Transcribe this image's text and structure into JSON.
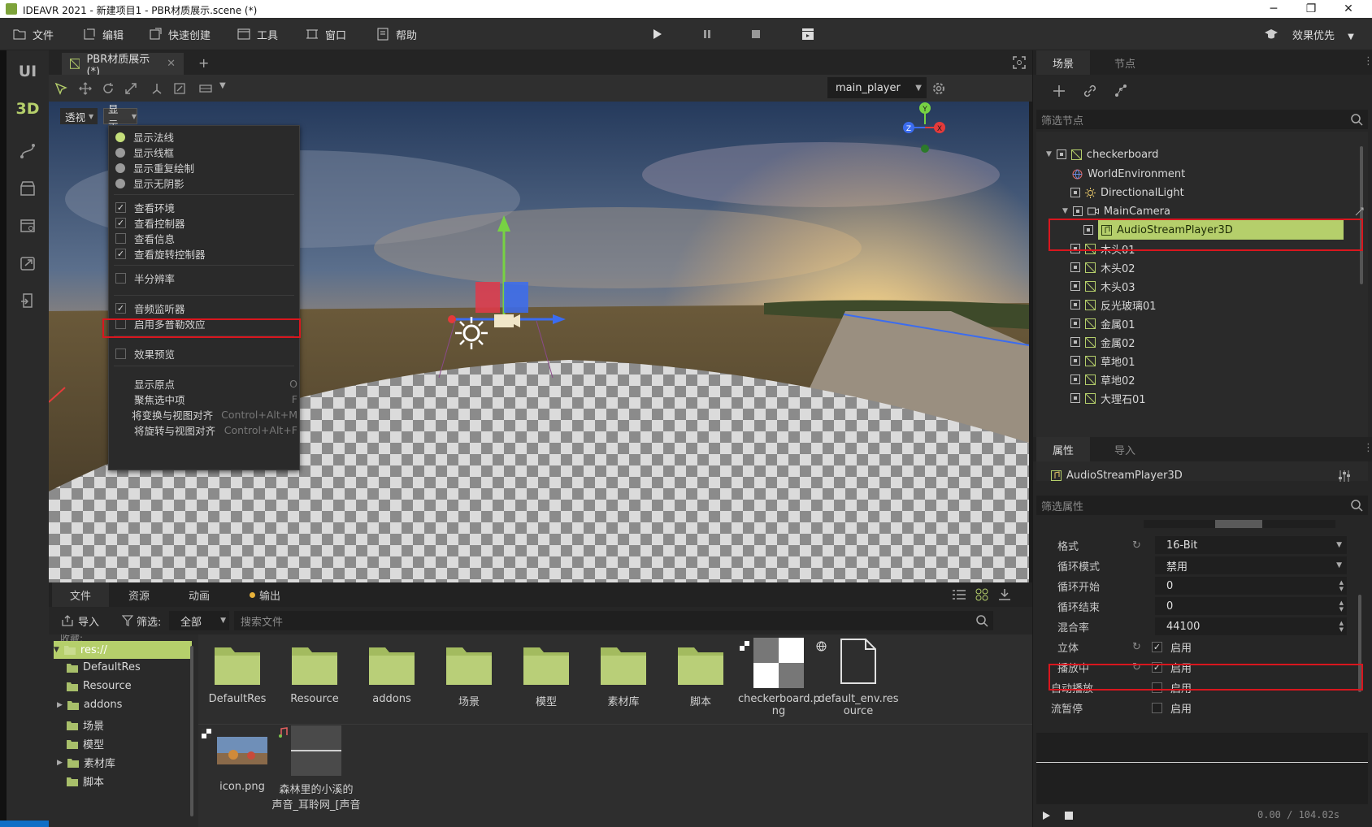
{
  "window": {
    "title": "IDEAVR 2021 - 新建项目1 - PBR材质展示.scene (*)",
    "minimize": "─",
    "maximize": "❐",
    "close": "✕"
  },
  "menubar": {
    "file": "文件",
    "edit": "编辑",
    "quick_create": "快速创建",
    "tools": "工具",
    "window": "窗口",
    "help": "帮助",
    "render_mode": "效果优先"
  },
  "leftdock": {
    "ui": "UI",
    "d3": "3D"
  },
  "editor": {
    "tab_label": "PBR材质展示(*)",
    "camera_select": "main_player",
    "view_persp": "透视",
    "view_display": "显示",
    "gizmo": {
      "x": "X",
      "y": "Y",
      "z": "Z"
    }
  },
  "display_menu": {
    "items": [
      {
        "label": "显示法线",
        "kind": "radio",
        "on": true
      },
      {
        "label": "显示线框",
        "kind": "radio",
        "on": false
      },
      {
        "label": "显示重复绘制",
        "kind": "radio",
        "on": false
      },
      {
        "label": "显示无阴影",
        "kind": "radio",
        "on": false
      },
      {
        "label": "查看环境",
        "kind": "check",
        "on": true
      },
      {
        "label": "查看控制器",
        "kind": "check",
        "on": true
      },
      {
        "label": "查看信息",
        "kind": "check",
        "on": false
      },
      {
        "label": "查看旋转控制器",
        "kind": "check",
        "on": true
      },
      {
        "label": "半分辨率",
        "kind": "check",
        "on": false
      },
      {
        "label": "音频监听器",
        "kind": "check",
        "on": true
      },
      {
        "label": "启用多普勒效应",
        "kind": "check",
        "on": false
      },
      {
        "label": "效果预览",
        "kind": "check",
        "on": false
      },
      {
        "label": "显示原点",
        "kind": "plain",
        "shortcut": "O"
      },
      {
        "label": "聚焦选中项",
        "kind": "plain",
        "shortcut": "F"
      },
      {
        "label": "将变换与视图对齐",
        "kind": "plain",
        "shortcut": "Control+Alt+M"
      },
      {
        "label": "将旋转与视图对齐",
        "kind": "plain",
        "shortcut": "Control+Alt+F"
      }
    ]
  },
  "bottom": {
    "tabs": [
      "文件",
      "资源",
      "动画",
      "输出"
    ],
    "import_label": "导入",
    "filter_label": "筛选:",
    "filter_value": "全部",
    "search_placeholder": "搜索文件",
    "fav_label": "收藏:",
    "tree": [
      "res://",
      "DefaultRes",
      "Resource",
      "addons",
      "场景",
      "模型",
      "素材库",
      "脚本"
    ],
    "files_row1": [
      "DefaultRes",
      "Resource",
      "addons",
      "场景",
      "模型",
      "素材库",
      "脚本"
    ],
    "checker_name": [
      "checkerboard.p",
      "ng"
    ],
    "env_name": [
      "default_env.res",
      "ource"
    ],
    "icon_name": "icon.png",
    "audio_name": [
      "森林里的小溪的",
      "声音_耳聆网_[声音"
    ]
  },
  "scene_panel": {
    "tabs": [
      "场景",
      "节点"
    ],
    "filter_placeholder": "筛选节点",
    "nodes": [
      {
        "label": "checkerboard"
      },
      {
        "label": "WorldEnvironment"
      },
      {
        "label": "DirectionalLight"
      },
      {
        "label": "MainCamera"
      },
      {
        "label": "AudioStreamPlayer3D"
      },
      {
        "label": "木头01"
      },
      {
        "label": "木头02"
      },
      {
        "label": "木头03"
      },
      {
        "label": "反光玻璃01"
      },
      {
        "label": "金属01"
      },
      {
        "label": "金属02"
      },
      {
        "label": "草地01"
      },
      {
        "label": "草地02"
      },
      {
        "label": "大理石01"
      }
    ]
  },
  "inspector": {
    "tabs": [
      "属性",
      "导入"
    ],
    "node_name": "AudioStreamPlayer3D",
    "filter_placeholder": "筛选属性",
    "props": [
      {
        "label": "格式",
        "value": "16-Bit"
      },
      {
        "label": "循环模式",
        "value": "禁用"
      },
      {
        "label": "循环开始",
        "value": "0"
      },
      {
        "label": "循环结束",
        "value": "0"
      },
      {
        "label": "混合率",
        "value": "44100"
      },
      {
        "label": "立体",
        "value": "启用"
      },
      {
        "label": "播放中",
        "value": "启用"
      },
      {
        "label": "自动播放",
        "value": "启用"
      },
      {
        "label": "流暂停",
        "value": "启用"
      }
    ],
    "time": "0.00 / 104.02s"
  },
  "colors": {
    "accent": "#b5cf6b",
    "highlight": "#d9161e",
    "bg": "#262626"
  }
}
